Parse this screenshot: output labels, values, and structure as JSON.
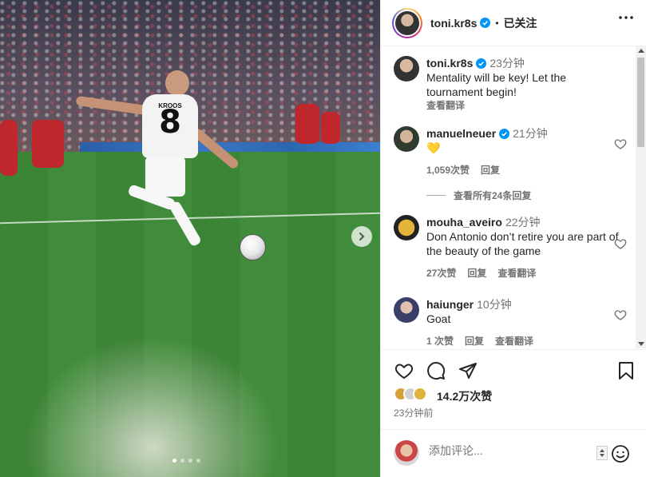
{
  "post": {
    "author": "toni.kr8s",
    "header_separator": "•",
    "follow_label": "已关注",
    "carousel": {
      "slide_count": 4,
      "active_index": 0
    },
    "player_shirt_number": "8",
    "player_shirt_name": "KROOS"
  },
  "caption": {
    "username": "toni.kr8s",
    "time": "23分钟",
    "text": "Mentality will be key! Let the tournament begin!",
    "translate": "查看翻译"
  },
  "comments": [
    {
      "username": "manuelneuer",
      "verified": true,
      "time": "21分钟",
      "text": "💛",
      "likes": "1,059次赞",
      "reply": "回复",
      "translate": ""
    },
    {
      "username": "mouha_aveiro",
      "verified": false,
      "time": "22分钟",
      "text": "Don Antonio don’t retire you are part of the beauty of the game",
      "likes": "27次赞",
      "reply": "回复",
      "translate": "查看翻译"
    },
    {
      "username": "haiunger",
      "verified": false,
      "time": "10分钟",
      "text": "Goat",
      "likes": "1 次赞",
      "reply": "回复",
      "translate": "查看翻译"
    }
  ],
  "view_replies": "查看所有24条回复",
  "stats": {
    "likes": "14.2万次赞",
    "posted": "23分钟前"
  },
  "add_comment": {
    "placeholder": "添加评论..."
  },
  "colors": {
    "verified_blue": "#0095f6",
    "text_primary": "#262626",
    "text_secondary": "#737373",
    "border": "#efefef"
  },
  "icons": [
    "more-icon",
    "verified-icon",
    "heart-icon",
    "comment-icon",
    "share-icon",
    "save-icon",
    "emoji-icon",
    "chevron-right-icon"
  ]
}
